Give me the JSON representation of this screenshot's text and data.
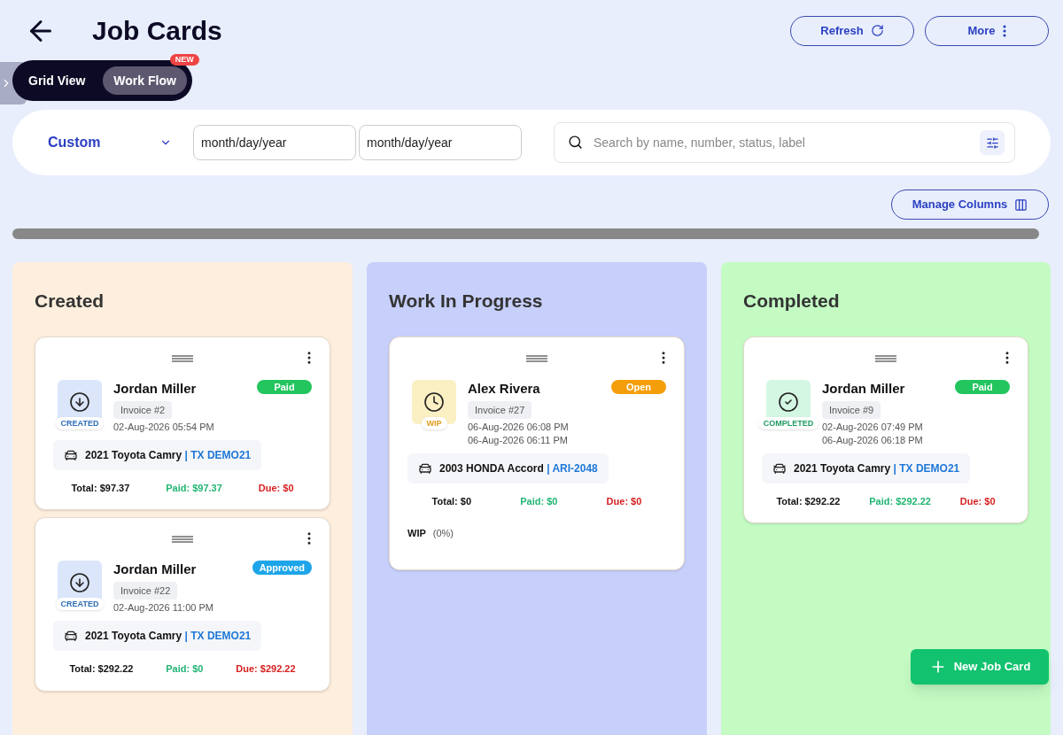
{
  "header": {
    "title": "Job Cards",
    "buttons": [
      {
        "label": "Refresh",
        "kind": "refresh"
      },
      {
        "label": "More",
        "kind": "more"
      }
    ]
  },
  "view_toggle": {
    "tabs": [
      {
        "label": "Grid View",
        "selected": false
      },
      {
        "label": "Work Flow",
        "selected": true,
        "badge": "NEW"
      }
    ]
  },
  "filters": {
    "range": "Custom",
    "date_from": {
      "placeholder": "month/day/year"
    },
    "date_to": {
      "placeholder": "month/day/year"
    },
    "search": {
      "placeholder": "Search by name, number, status, label"
    }
  },
  "manage_columns": "Manage Columns",
  "columns": [
    {
      "title": "Created",
      "color": "#fdeedd",
      "cards": [
        {
          "kind": "created",
          "stage_label": "CREATED",
          "name": "Jordan Miller",
          "status": {
            "label": "Paid",
            "color": "#22c55e"
          },
          "invoice": "Invoice #2",
          "dates": [
            "02-Aug-2026 05:54 PM"
          ],
          "vehicle": "2021 Toyota Camry",
          "plate": "| TX DEMO21",
          "total": "Total: $97.37",
          "paid": "Paid: $97.37",
          "due": "Due: $0"
        },
        {
          "kind": "created",
          "stage_label": "CREATED",
          "name": "Jordan Miller",
          "status": {
            "label": "Approved",
            "color": "#1ea5e9"
          },
          "invoice": "Invoice #22",
          "dates": [
            "02-Aug-2026 11:00 PM"
          ],
          "vehicle": "2021 Toyota Camry",
          "plate": "| TX DEMO21",
          "total": "Total: $292.22",
          "paid": "Paid: $0",
          "due": "Due: $292.22"
        }
      ]
    },
    {
      "title": "Work In Progress",
      "color": "#c7cffb",
      "cards": [
        {
          "kind": "wip",
          "stage_label": "WIP",
          "name": "Alex Rivera",
          "status": {
            "label": "Open",
            "color": "#f59e0b"
          },
          "invoice": "Invoice #27",
          "dates": [
            "06-Aug-2026 06:08 PM",
            "06-Aug-2026 06:11 PM"
          ],
          "vehicle": "2003 HONDA Accord",
          "plate": "| ARI-2048",
          "total": "Total: $0",
          "paid": "Paid: $0",
          "due": "Due: $0",
          "progress": {
            "label": "WIP",
            "value": "(0%)"
          }
        }
      ]
    },
    {
      "title": "Completed",
      "color": "#c3fbc3",
      "cards": [
        {
          "kind": "completed",
          "stage_label": "COMPLETED",
          "name": "Jordan Miller",
          "status": {
            "label": "Paid",
            "color": "#22c55e"
          },
          "invoice": "Invoice #9",
          "dates": [
            "02-Aug-2026 07:49 PM",
            "06-Aug-2026 06:18 PM"
          ],
          "vehicle": "2021 Toyota Camry",
          "plate": "| TX DEMO21",
          "total": "Total: $292.22",
          "paid": "Paid: $292.22",
          "due": "Due: $0"
        }
      ]
    }
  ],
  "fab": "New Job Card"
}
